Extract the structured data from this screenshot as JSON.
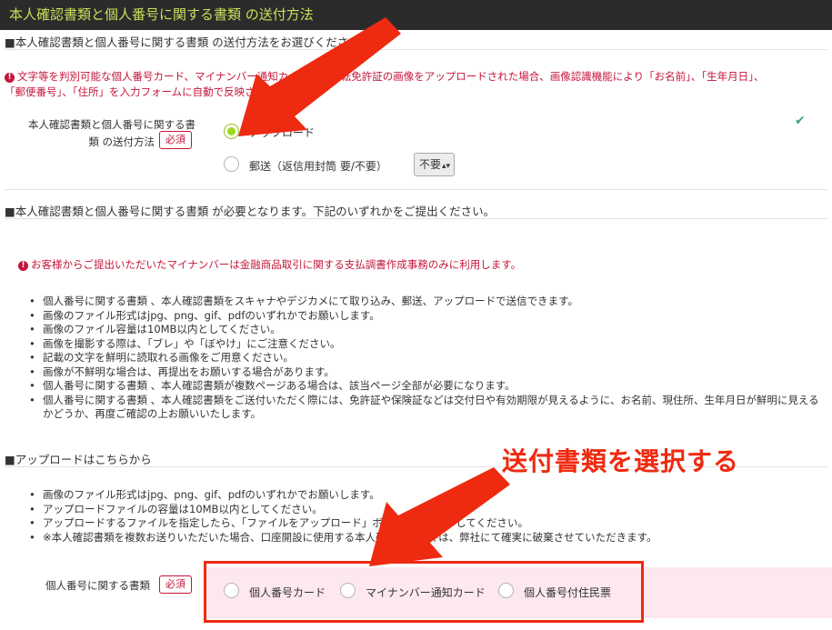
{
  "header": {
    "title": "本人確認書類と個人番号に関する書類 の送付方法"
  },
  "section1": {
    "heading": "■本人確認書類と個人番号に関する書類 の送付方法をお選びください。",
    "warning_line1": "文字等を判別可能な個人番号カード、マイナンバー通知カード又は運転免許証の画像をアップロードされた場合、画像認識機能により「お名前」、「生年月日」、",
    "warning_line2": "「郵便番号」、「住所」を入力フォームに自動で反映させます。",
    "field_label_line1": "本人確認書類と個人番号に関する書",
    "field_label_line2": "類 の送付方法",
    "required_badge": "必須",
    "options": [
      {
        "label": "アップロード",
        "selected": true
      },
      {
        "label": "郵送（返信用封筒 要/不要）",
        "selected": false
      }
    ],
    "envelope_select_value": "不要",
    "check_mark": "✔"
  },
  "section2": {
    "heading": "■本人確認書類と個人番号に関する書類 が必要となります。下記のいずれかをご提出ください。",
    "warning": "お客様からご提出いただいたマイナンバーは金融商品取引に関する支払調書作成事務のみに利用します。",
    "bullets": [
      "個人番号に関する書類 、本人確認書類をスキャナやデジカメにて取り込み、郵送、アップロードで送信できます。",
      "画像のファイル形式はjpg、png、gif、pdfのいずれかでお願いします。",
      "画像のファイル容量は10MB以内としてください。",
      "画像を撮影する際は、「ブレ」や「ぼやけ」にご注意ください。",
      "記載の文字を鮮明に読取れる画像をご用意ください。",
      "画像が不鮮明な場合は、再提出をお願いする場合があります。",
      "個人番号に関する書類 、本人確認書類が複数ページある場合は、該当ページ全部が必要になります。",
      "個人番号に関する書類 、本人確認書類をご送付いただく際には、免許証や保険証などは交付日や有効期限が見えるように、お名前、現住所、生年月日が鮮明に見えるかどうか、再度ご確認の上お願いいたします。"
    ]
  },
  "section3": {
    "heading": "■アップロードはこちらから",
    "bullets": [
      "画像のファイル形式はjpg、png、gif、pdfのいずれかでお願いします。",
      "アップロードファイルの容量は10MB以内としてください。",
      "アップロードするファイルを指定したら、「ファイルをアップロード」ボタンをクリックしてください。",
      "※本人確認書類を複数お送りいただいた場合、口座開設に使用する本人確認書類以外は、弊社にて確実に破棄させていただきます。"
    ],
    "field_label": "個人番号に関する書類",
    "required_badge": "必須",
    "doc_options": [
      "個人番号カード",
      "マイナンバー通知カード",
      "個人番号付住民票"
    ]
  },
  "annotation": {
    "callout_text": "送付書類を選択する",
    "arrow_color": "#ee2a10"
  }
}
